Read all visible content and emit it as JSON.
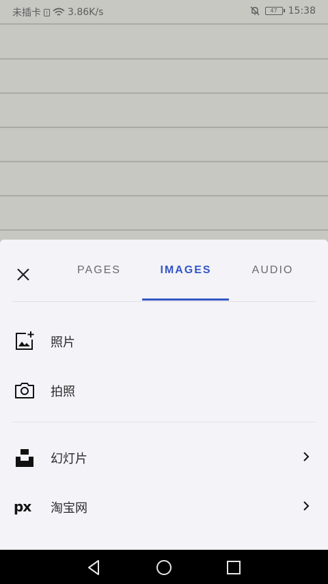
{
  "status_bar": {
    "carrier": "未插卡",
    "sim_mark": "!",
    "net_speed": "3.86K/s",
    "battery": "47",
    "time": "15:38"
  },
  "sheet": {
    "tabs": [
      {
        "label": "PAGES",
        "active": false
      },
      {
        "label": "IMAGES",
        "active": true
      },
      {
        "label": "AUDIO",
        "active": false
      }
    ],
    "sources": [
      {
        "label": "照片",
        "icon": "add-photo-icon"
      },
      {
        "label": "拍照",
        "icon": "camera-icon"
      }
    ],
    "services": [
      {
        "label": "幻灯片",
        "icon": "unsplash-logo-icon"
      },
      {
        "label": "淘宝网",
        "icon": "pixabay-logo-icon",
        "logo_text": "px"
      }
    ]
  },
  "colors": {
    "accent": "#3456c4",
    "sheet_bg": "#f3f3f8",
    "page_bg": "#c7c8c2"
  }
}
